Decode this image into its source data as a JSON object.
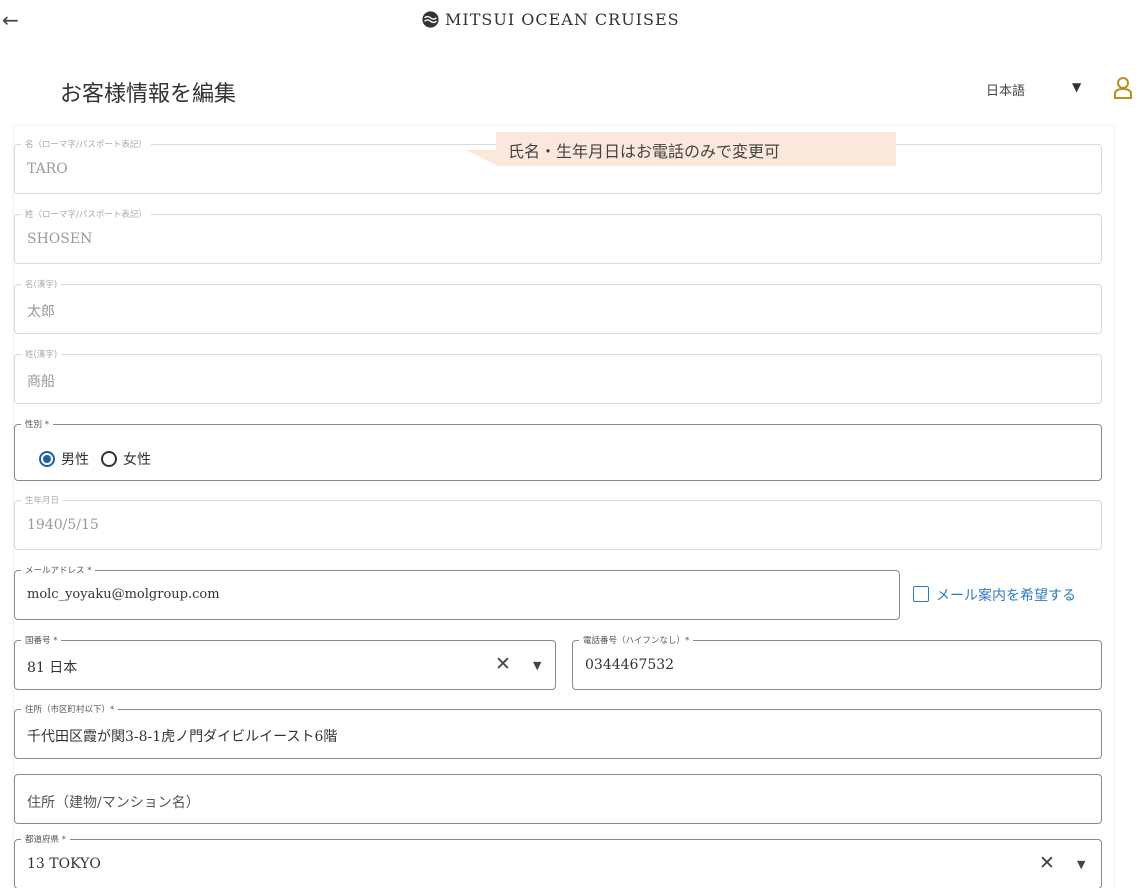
{
  "header": {
    "brand": "MITSUI OCEAN CRUISES",
    "title": "お客様情報を編集",
    "language": "日本語"
  },
  "tooltip": "氏名・生年月日はお電話のみで変更可",
  "fields": {
    "first_name_roman": {
      "label": "名（ローマ字/パスポート表記）",
      "value": "TARO"
    },
    "last_name_roman": {
      "label": "姓（ローマ字/パスポート表記）",
      "value": "SHOSEN"
    },
    "first_name_kanji": {
      "label": "名(漢字)",
      "value": "太郎"
    },
    "last_name_kanji": {
      "label": "姓(漢字)",
      "value": "商船"
    },
    "gender": {
      "label": "性別 *",
      "options": [
        "男性",
        "女性"
      ],
      "selected": "男性"
    },
    "birthdate": {
      "label": "生年月日",
      "value": "1940/5/15"
    },
    "email": {
      "label": "メールアドレス *",
      "value": "molc_yoyaku@molgroup.com"
    },
    "email_opt_in": {
      "label": "メール案内を希望する",
      "checked": false
    },
    "country_code": {
      "label": "国番号 *",
      "value": "81 日本"
    },
    "phone": {
      "label": "電話番号（ハイフンなし）*",
      "value": "0344467532"
    },
    "address1": {
      "label": "住所（市区町村以下）*",
      "value": "千代田区霞が関3-8-1虎ノ門ダイビルイースト6階"
    },
    "address2": {
      "placeholder": "住所（建物/マンション名）"
    },
    "prefecture": {
      "label": "都道府県 *",
      "value": "13 TOKYO"
    }
  },
  "icons": {
    "back": "arrow-left",
    "clear": "x",
    "dropdown": "caret-down",
    "user": "user-outline",
    "accent_color": "#1f5fa8",
    "link_color": "#2b7bbf",
    "tooltip_color": "#fbe8dc"
  }
}
